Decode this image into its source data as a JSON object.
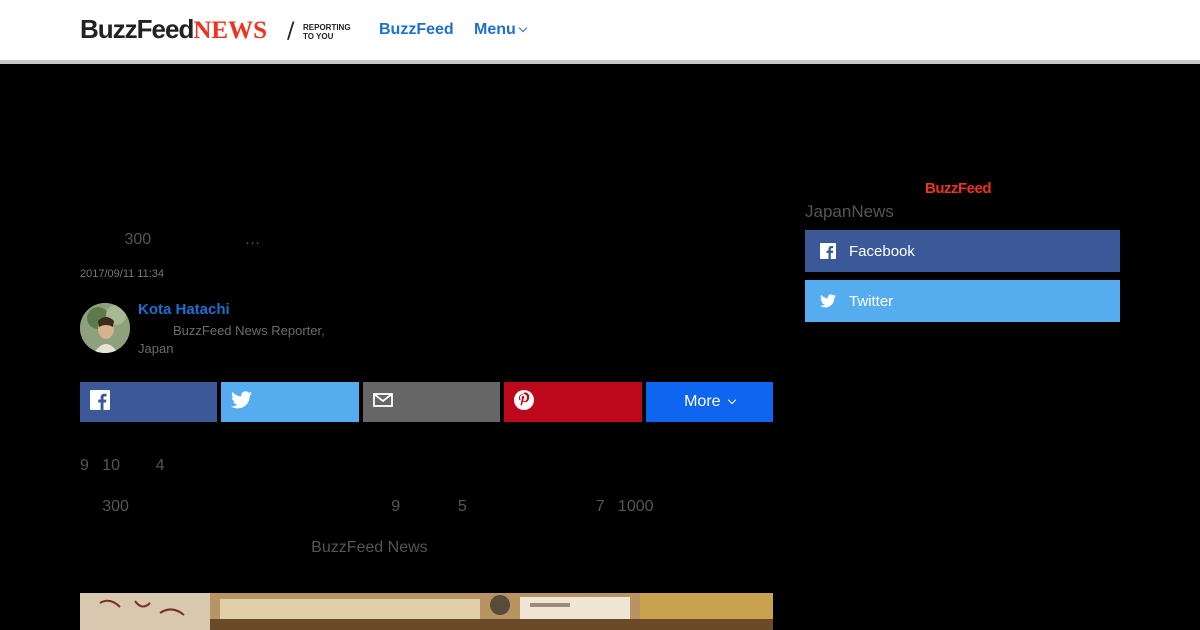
{
  "header": {
    "logo_main": "BuzzFeed",
    "logo_news": "NEWS",
    "logo_slash": "/",
    "tagline_line1": "REPORTING",
    "tagline_line2": "TO YOU",
    "nav_buzzfeed": "BuzzFeed",
    "nav_menu": "Menu"
  },
  "article": {
    "headline": "          300                     …",
    "timestamp": "2017/09/11 11:34",
    "author": {
      "name": "Kota Hatachi",
      "role": "BuzzFeed News Reporter, Japan"
    },
    "share": {
      "more_label": "More"
    },
    "body": [
      "9   10        4",
      "     300                                                           9             5                             7   1000",
      "                                                    BuzzFeed News"
    ]
  },
  "sidebar": {
    "logo": "BuzzFeed",
    "handle": "JapanNews",
    "facebook_label": "Facebook",
    "twitter_label": "Twitter"
  },
  "colors": {
    "link_blue": "#1d6fd1",
    "facebook": "#3b5998",
    "twitter": "#55acee",
    "email": "#666666",
    "pinterest": "#bd081c",
    "more": "#0f65ef",
    "buzzfeed_red": "#ee3322"
  },
  "icons": [
    "facebook-icon",
    "twitter-icon",
    "email-icon",
    "pinterest-icon",
    "chevron-down-icon"
  ]
}
